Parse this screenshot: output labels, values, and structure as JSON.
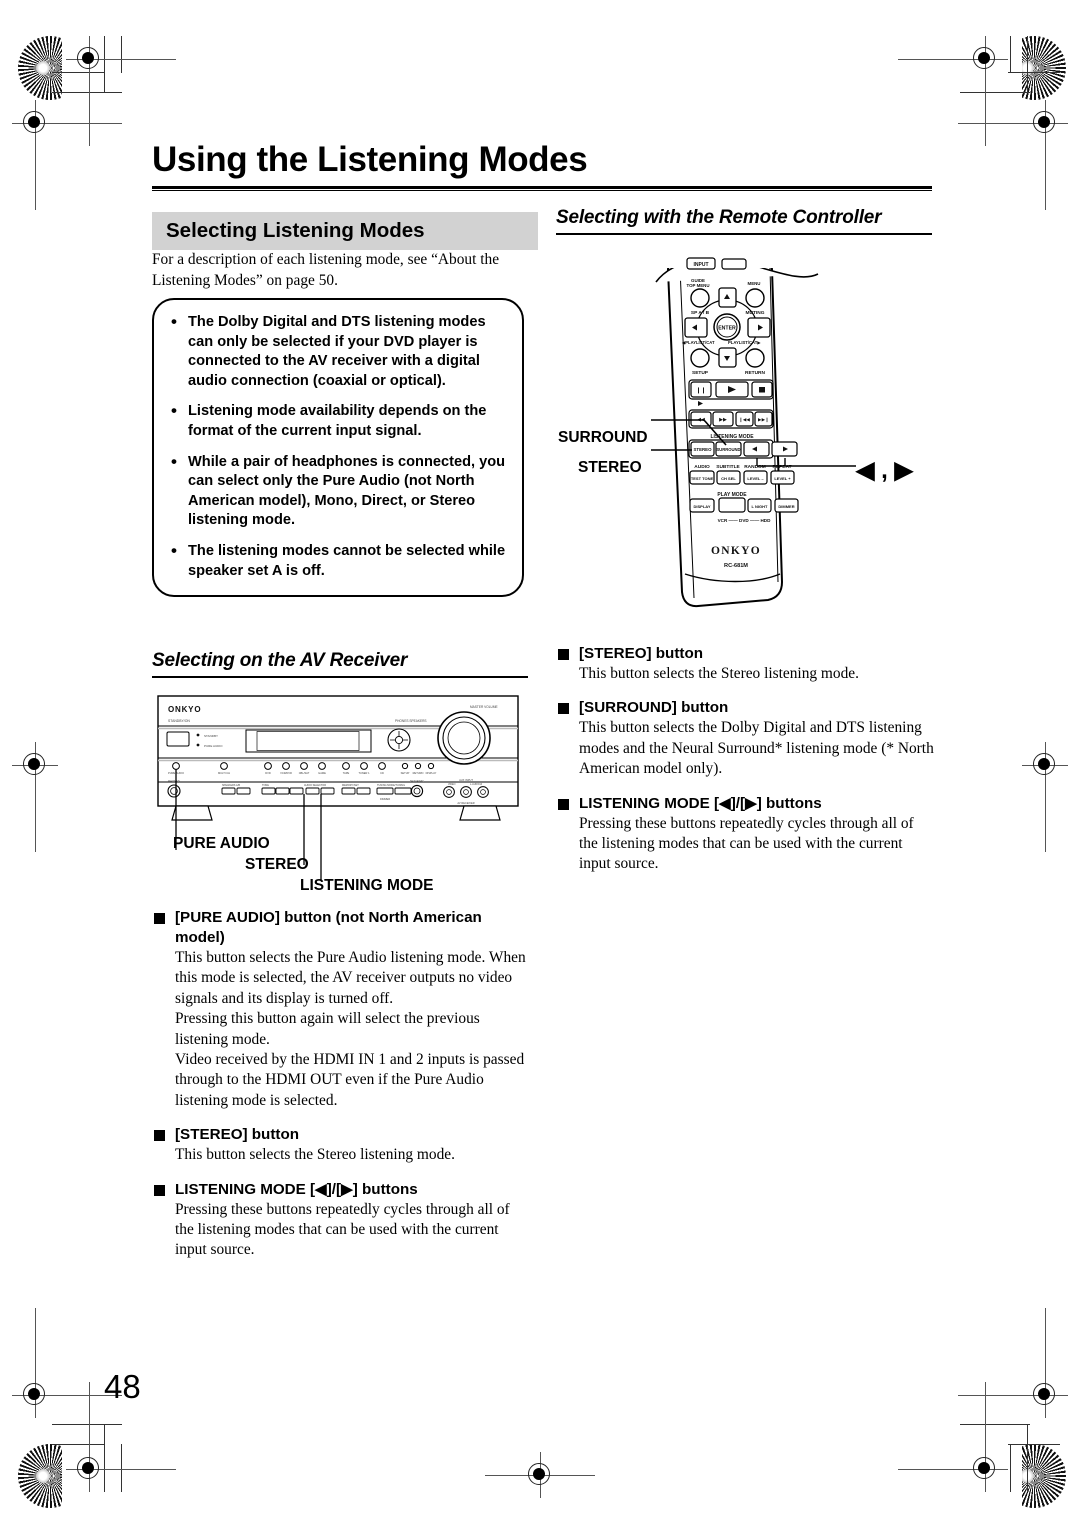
{
  "page": {
    "title": "Using the Listening Modes",
    "number": "48"
  },
  "left_column": {
    "section_heading": "Selecting Listening Modes",
    "intro": "For a description of each listening mode, see “About the Listening Modes” on page 50.",
    "notes": [
      "The Dolby Digital and DTS listening modes can only be selected if your DVD player is connected to the AV receiver with a digital audio connection (coaxial or optical).",
      "Listening mode availability depends on the format of the current input signal.",
      "While a pair of headphones is connected, you can select only the Pure Audio (not North American model), Mono, Direct, or Stereo listening mode.",
      "The listening modes cannot be selected while speaker set A is off."
    ],
    "subsection_heading": "Selecting on the AV Receiver",
    "receiver_callouts": [
      "PURE AUDIO",
      "STEREO",
      "LISTENING MODE"
    ],
    "receiver_brand": "ONKYO",
    "entries": [
      {
        "heading": "[PURE AUDIO] button (not North American model)",
        "paragraphs": [
          "This button selects the Pure Audio listening mode. When this mode is selected, the AV receiver outputs no video signals and its display is turned off.",
          "Pressing this button again will select the previous listening mode.",
          "Video received by the HDMI IN 1 and 2 inputs is passed through to the HDMI OUT even if the Pure Audio listening mode is selected."
        ]
      },
      {
        "heading": "[STEREO] button",
        "paragraphs": [
          "This button selects the Stereo listening mode."
        ]
      },
      {
        "heading": "LISTENING MODE [◀]/[▶] buttons",
        "paragraphs": [
          "Pressing these buttons repeatedly cycles through all of the listening modes that can be used with the current input source."
        ]
      }
    ]
  },
  "right_column": {
    "subsection_heading": "Selecting with the Remote Controller",
    "remote": {
      "brand": "ONKYO",
      "model": "RC-681M",
      "callouts": [
        "SURROUND",
        "STEREO"
      ],
      "arrow_callout": "◀ , ▶",
      "button_labels": {
        "input": "INPUT",
        "guide_top_menu": "GUIDE\nTOP MENU",
        "menu": "MENU",
        "sp_ab": "SP A / B",
        "muting": "MUTING",
        "enter": "ENTER",
        "playlist_cat_left": "◀PLAYLIST/CAT",
        "playlist_cat_right": "PLAYLIST/CAT▶",
        "setup": "SETUP",
        "return": "RETURN",
        "listening_mode": "LISTENING MODE",
        "stereo": "STEREO",
        "surround": "SURROUND",
        "audio": "AUDIO",
        "subtitle": "SUBTITLE",
        "random": "RANDOM",
        "repeat": "REPEAT",
        "test_tone": "TEST TONE",
        "ch_sel": "CH SEL",
        "level_minus": "LEVEL –",
        "level_plus": "LEVEL +",
        "play_mode": "PLAY MODE",
        "display": "DISPLAY",
        "l_night": "L NIGHT",
        "dimmer": "DIMMER",
        "sources": "VCR —— DVD —— HDD"
      }
    },
    "entries": [
      {
        "heading": "[STEREO] button",
        "paragraphs": [
          "This button selects the Stereo listening mode."
        ]
      },
      {
        "heading": "[SURROUND] button",
        "paragraphs": [
          "This button selects the Dolby Digital and DTS listening modes and the Neural Surround* listening mode (* North American model only)."
        ]
      },
      {
        "heading": "LISTENING MODE [◀]/[▶] buttons",
        "paragraphs": [
          "Pressing these buttons repeatedly cycles through all of the listening modes that can be used with the current input source."
        ]
      }
    ]
  },
  "colors": {
    "ink": "#000000",
    "section_header_bg": "#d2d2d2",
    "mark_gray": "#555555"
  }
}
